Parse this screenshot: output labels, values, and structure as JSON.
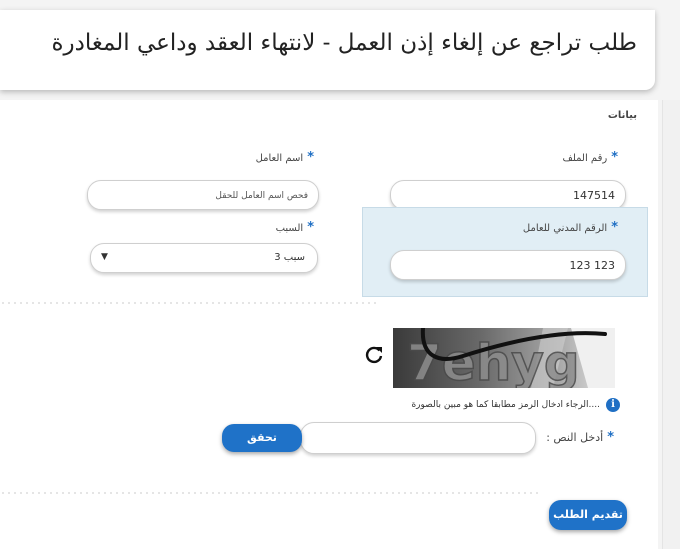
{
  "header": {
    "title": "طلب تراجع عن إلغاء إذن العمل - لانتهاء العقد وداعي المغادرة"
  },
  "form": {
    "section_title": "بيانات",
    "file_number": {
      "label": "رقم الملف",
      "value": "147514"
    },
    "worker_name": {
      "label": "اسم العامل",
      "value": "فحص اسم العامل للحقل"
    },
    "civil_id": {
      "label": "الرقم المدني للعامل",
      "value": "123 123"
    },
    "reason": {
      "label": "السبب",
      "value": "سبب 3"
    },
    "required_mark": "*"
  },
  "captcha": {
    "image_text": "7ehyg",
    "info_text": "....الرجاء ادخال الرمز مطابقا كما هو مبين بالصورة",
    "input_label": "أدخل النص :",
    "input_value": "",
    "verify_label": "تحقق",
    "icons": {
      "refresh": "refresh-icon",
      "info": "info-icon"
    }
  },
  "actions": {
    "submit_label": "تقديم الطلب"
  },
  "colors": {
    "accent": "#1f72c8",
    "highlight": "#e1eef5"
  }
}
